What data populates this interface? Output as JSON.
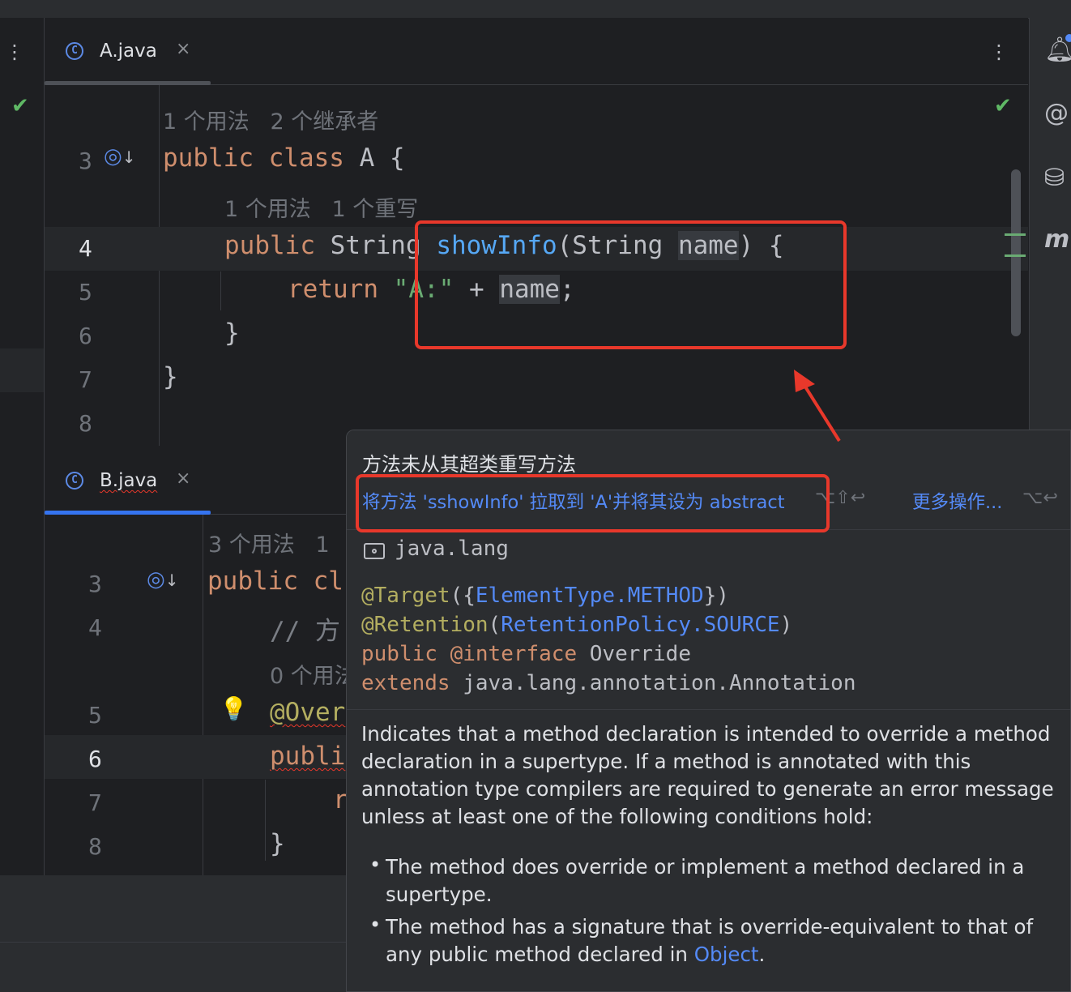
{
  "editor_a": {
    "tab": {
      "label": "A.java",
      "close": "×"
    },
    "kebab": "⋮",
    "hints": {
      "class": "1 个用法   2 个继承者",
      "method": "1 个用法   1 个重写"
    },
    "lines": [
      "3",
      "4",
      "5",
      "6",
      "7",
      "8"
    ],
    "code": {
      "l3": {
        "kw": "public class ",
        "rest": "A {"
      },
      "l4": {
        "kw": "public ",
        "type": "String ",
        "fn": "showInfo",
        "open": "(String ",
        "param": "name",
        "close": ") {"
      },
      "l5": {
        "kw": "return ",
        "str": "\"A:\"",
        "plus": " + ",
        "var": "name",
        "end": ";"
      },
      "l6": "}",
      "l7": "}"
    }
  },
  "editor_b": {
    "tab": {
      "label": "B.java",
      "close": "×"
    },
    "hints": {
      "class": "3 个用法   1",
      "method": "0 个用法"
    },
    "lines": [
      "3",
      "4",
      "5",
      "6",
      "7",
      "8"
    ],
    "code": {
      "l3_kw": "public cl",
      "l4_cmt": "// 方",
      "l5_ann": "@Over",
      "l6_kw": "publi",
      "l7": "r",
      "l8": "}"
    }
  },
  "popup": {
    "title": "方法未从其超类重写方法",
    "fix_action": "将方法 'sshowInfo' 拉取到 'A'并将其设为 abstract",
    "fix_shortcut": "⌥⇧↩",
    "more_actions": "更多操作...",
    "more_shortcut": "⌥↩",
    "package": "java.lang",
    "decl": {
      "target_ann": "@Target",
      "target_open": "({",
      "target_val": "ElementType.METHOD",
      "target_close": "})",
      "retention_ann": "@Retention",
      "retention_open": "(",
      "retention_val": "RetentionPolicy.SOURCE",
      "retention_close": ")",
      "public_kw": "public",
      "interface_kw": " @interface ",
      "name": "Override",
      "extends_kw": "extends",
      "extends_type": " java.lang.annotation.Annotation"
    },
    "description": "Indicates that a method declaration is intended to override a method declaration in a supertype. If a method is annotated with this annotation type compilers are required to generate an error message unless at least one of the following conditions hold:",
    "bullets": [
      "The method does override or implement a method declared in a supertype.",
      "The method has a signature that is override-equivalent to that of any public method declared in"
    ],
    "bullet2_link": "Object",
    "bullet2_end": ".",
    "bullet_char": "•"
  },
  "colors": {
    "highlight_box": "#e8382b",
    "accent": "#548af7",
    "background": "#1e1f22"
  },
  "icons": {
    "left_strip_top": "kebab-icon",
    "check": "check-icon",
    "right_bar": [
      "notifications-icon",
      "ai-assistant-icon",
      "database-icon",
      "maven-icon"
    ]
  }
}
